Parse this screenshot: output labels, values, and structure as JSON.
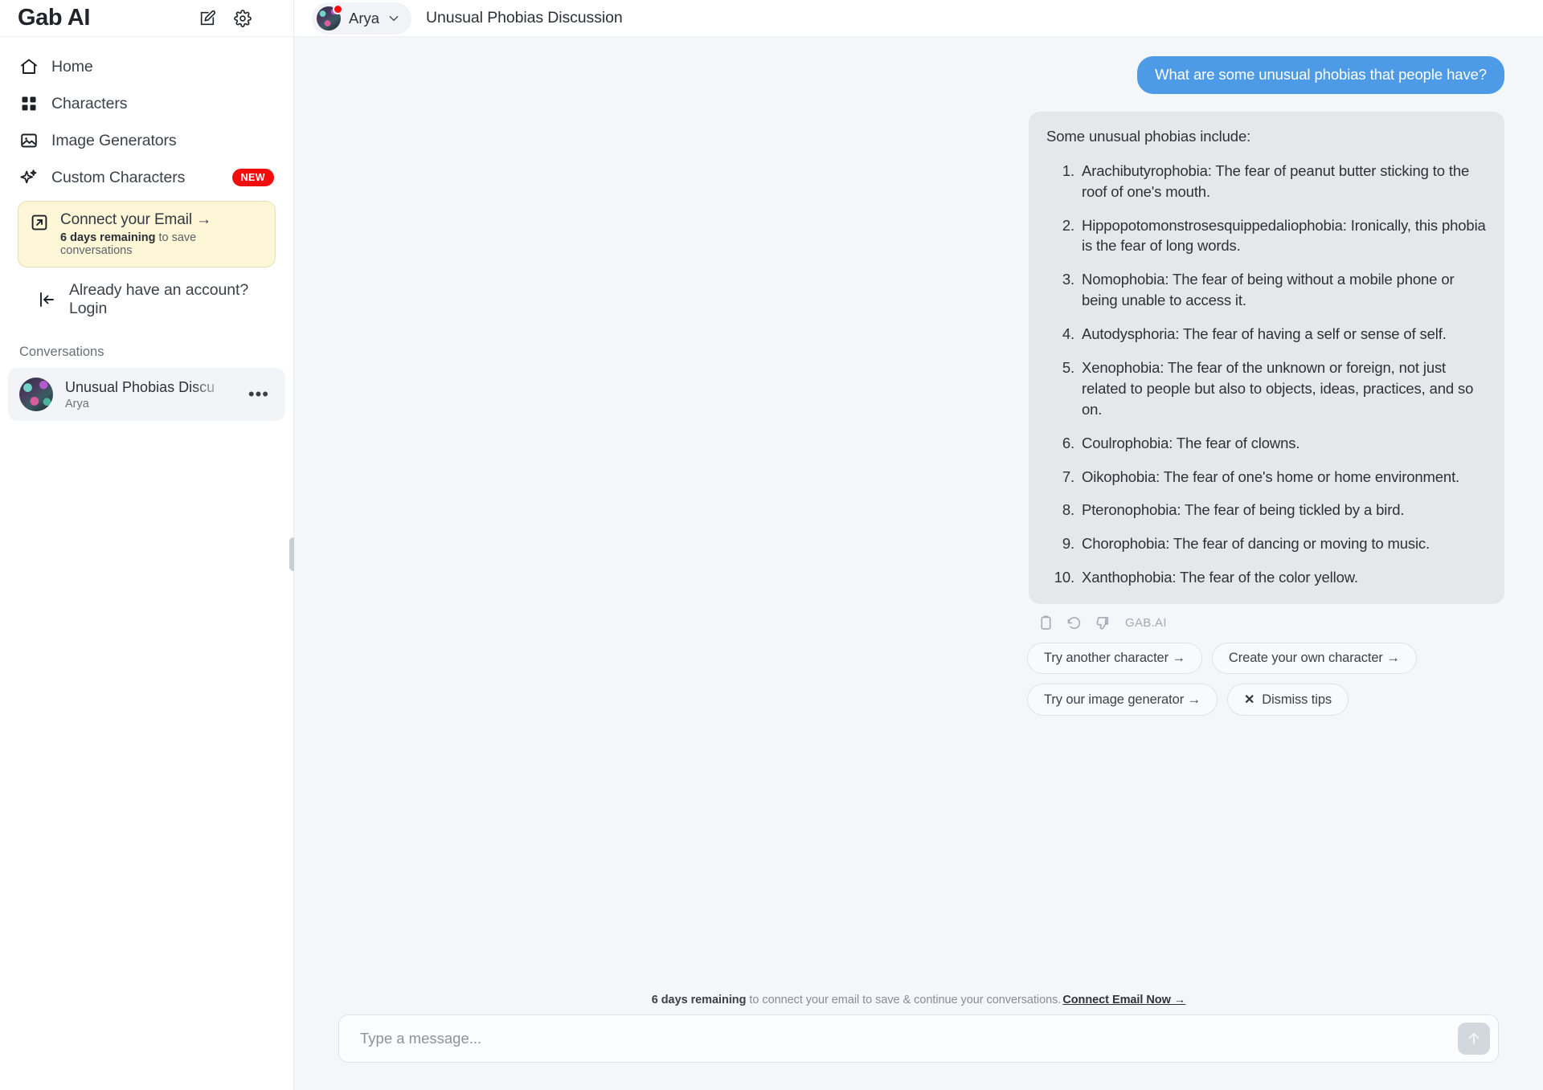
{
  "sidebar": {
    "brand": "Gab AI",
    "top_icons": [
      {
        "name": "compose-icon",
        "label": "New chat"
      },
      {
        "name": "gear-icon",
        "label": "Settings"
      }
    ],
    "nav": [
      {
        "label": "Home",
        "icon": "home-icon"
      },
      {
        "label": "Characters",
        "icon": "grid-icon"
      },
      {
        "label": "Image Generators",
        "icon": "image-icon"
      },
      {
        "label": "Custom Characters",
        "icon": "sparkle-icon",
        "badge": "NEW"
      }
    ],
    "email_card": {
      "title": "Connect your Email →",
      "days": "6 days remaining",
      "sub": " to save conversations",
      "icon": "external-link-icon"
    },
    "login": {
      "label": "Already have an account? Login",
      "icon": "login-arrow-icon"
    },
    "conversations_label": "Conversations",
    "conversations": [
      {
        "title": "Unusual Phobias Discu",
        "subtitle": "Arya",
        "menu": "•••"
      }
    ]
  },
  "header": {
    "character": "Arya",
    "conversation_title": "Unusual Phobias Discussion"
  },
  "thread": {
    "user_message": "What are some unusual phobias that people have?",
    "bot_intro": "Some unusual phobias include:",
    "bot_list": [
      "Arachibutyrophobia: The fear of peanut butter sticking to the roof of one's mouth.",
      "Hippopotomonstrosesquippedaliophobia: Ironically, this phobia is the fear of long words.",
      "Nomophobia: The fear of being without a mobile phone or being unable to access it.",
      "Autodysphoria: The fear of having a self or sense of self.",
      "Xenophobia: The fear of the unknown or foreign, not just related to people but also to objects, ideas, practices, and so on.",
      "Coulrophobia: The fear of clowns.",
      "Oikophobia: The fear of one's home or home environment.",
      "Pteronophobia: The fear of being tickled by a bird.",
      "Chorophobia: The fear of dancing or moving to music.",
      "Xanthophobia: The fear of the color yellow."
    ],
    "actions": {
      "copy": "copy-icon",
      "regenerate": "regenerate-icon",
      "dislike": "thumbs-down-icon",
      "source_tag": "GAB.AI"
    },
    "chips": [
      "Try another character  →",
      "Create your own character  →",
      "Try our image generator  →"
    ],
    "dismiss_chip": "Dismiss tips",
    "dismiss_x": "✕"
  },
  "footer": {
    "days": "6 days remaining",
    "reminder": " to connect your email to save & continue your conversations.",
    "link": "Connect Email Now →",
    "composer_placeholder": "Type a message...",
    "composer_value": "",
    "send_icon": "arrow-up-icon"
  },
  "colors": {
    "accent_blue": "#4d9ae6",
    "badge_red": "#f00d0d",
    "email_card_bg": "#fdf7d8",
    "bot_bubble_bg": "#e6e7ea",
    "page_bg": "#f4f7fa"
  }
}
